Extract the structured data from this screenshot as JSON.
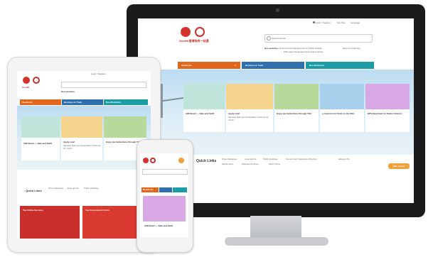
{
  "colors": {
    "orange": "#e2671c",
    "blue": "#2f6fad",
    "teal": "#1c9ca3",
    "red": "#c9302c"
  },
  "brand": {
    "logo_text": "GovHK",
    "logo_cn": "香港政府一站通"
  },
  "header": {
    "login": "Login / Register",
    "text_size": "Text Size",
    "language": "Language",
    "search_placeholder": "Search GovHK"
  },
  "popular": {
    "label": "Hot searches:",
    "items": [
      "Government Arrangements for Public Holiday",
      "Fifth-wave Designated Quarantine Hotels"
    ],
    "more": "More hot searches"
  },
  "tabs": [
    "Residents",
    "Business & Trade",
    "Non-Residents"
  ],
  "cards": [
    {
      "title": "iAM Smart － Safe and Swift",
      "color": "#7bc1b0"
    },
    {
      "title": "Apply now!",
      "body": "Member Self-recommendation Scheme for Youth",
      "color": "#f3c47a"
    },
    {
      "title": "Enjoy tax deductions through TVC",
      "color": "#8cc67a"
    },
    {
      "title": "e-Customs for Visits to the USA",
      "color": "#6aa6d8"
    },
    {
      "title": "EPS EasyCash for Senior Citizens",
      "color": "#b56ec9"
    }
  ],
  "quick_links": {
    "label": "Quick Links",
    "items": [
      "Press Releases",
      "news.gov.hk",
      "Public Holidays",
      "Government Telephone Directory",
      "data.gov.hk",
      "Mobile Apps",
      "Webcast Archives",
      "1823 Online"
    ]
  },
  "sections": {
    "top_online": "Top Online Services",
    "top_gov": "Top Government Forms"
  },
  "tablet": {
    "hot_label": "Hot searches:",
    "iam": "iAM Smart － Safe and Swift",
    "apply": "Apply now!",
    "apply_body": "Member Self-recommendation Scheme for Youth",
    "tax": "Enjoy tax deductions through TVC"
  },
  "phone": {
    "card": "iAM Smart － Safe and Swift",
    "tab": "Residents"
  },
  "help_btn": "Help Centre"
}
